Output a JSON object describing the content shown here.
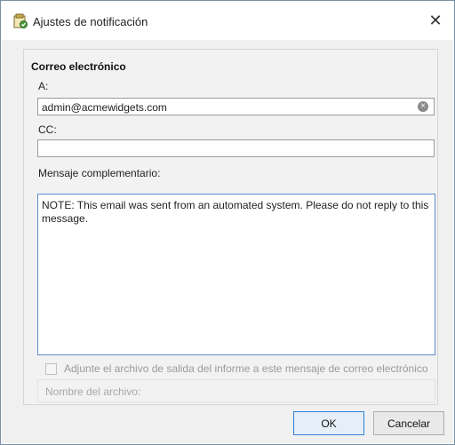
{
  "window": {
    "title": "Ajustes de notificación"
  },
  "email_section": {
    "title": "Correo electrónico",
    "to_label": "A:",
    "to_value": "admin@acmewidgets.com",
    "cc_label": "CC:",
    "cc_value": "",
    "message_label": "Mensaje complementario:",
    "message_value": "NOTE: This email was sent from an automated system. Please do not reply to this message.",
    "attach_label": "Adjunte el archivo de salida del informe a este mensaje de correo electrónico",
    "attach_checked": false,
    "filename_label": "Nombre del archivo:"
  },
  "buttons": {
    "ok_label": "OK",
    "cancel_label": "Cancelar"
  },
  "icons": {
    "title": "notification-settings-icon",
    "close": "close-icon",
    "clear": "clear-icon"
  },
  "colors": {
    "focus_border": "#5a8fd0",
    "default_button_border": "#2f7fd6"
  }
}
